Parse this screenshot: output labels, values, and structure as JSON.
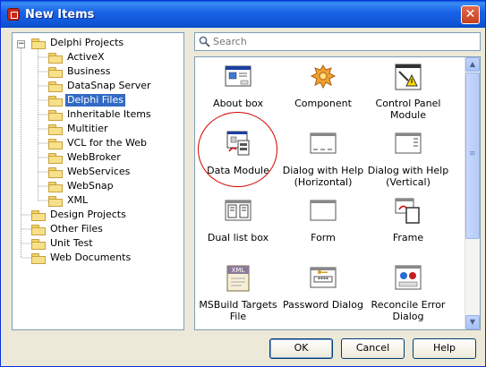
{
  "window": {
    "title": "New Items",
    "close_symbol": "✕"
  },
  "search": {
    "placeholder": "Search"
  },
  "tree": {
    "root": {
      "label": "Delphi Projects",
      "expander": "−"
    },
    "children": [
      {
        "label": "ActiveX"
      },
      {
        "label": "Business"
      },
      {
        "label": "DataSnap Server"
      },
      {
        "label": "Delphi Files",
        "selected": true
      },
      {
        "label": "Inheritable Items"
      },
      {
        "label": "Multitier"
      },
      {
        "label": "VCL for the Web"
      },
      {
        "label": "WebBroker"
      },
      {
        "label": "WebServices"
      },
      {
        "label": "WebSnap"
      },
      {
        "label": "XML"
      }
    ],
    "others": [
      {
        "label": "Design Projects"
      },
      {
        "label": "Other Files"
      },
      {
        "label": "Unit Test"
      },
      {
        "label": "Web Documents"
      }
    ]
  },
  "items": [
    {
      "caption": "About box",
      "icon": "about-box-icon"
    },
    {
      "caption": "Component",
      "icon": "component-icon"
    },
    {
      "caption": "Control Panel Module",
      "icon": "control-panel-module-icon"
    },
    {
      "caption": "Data Module",
      "icon": "data-module-icon",
      "highlighted": true
    },
    {
      "caption": "Dialog with Help (Horizontal)",
      "icon": "dialog-help-horizontal-icon"
    },
    {
      "caption": "Dialog with Help (Vertical)",
      "icon": "dialog-help-vertical-icon"
    },
    {
      "caption": "Dual list box",
      "icon": "dual-list-box-icon"
    },
    {
      "caption": "Form",
      "icon": "form-icon"
    },
    {
      "caption": "Frame",
      "icon": "frame-icon"
    },
    {
      "caption": "MSBuild Targets File",
      "icon": "msbuild-targets-icon",
      "icon_text": "XML"
    },
    {
      "caption": "Password Dialog",
      "icon": "password-dialog-icon",
      "icon_text": "****"
    },
    {
      "caption": "Reconcile Error Dialog",
      "icon": "reconcile-error-dialog-icon"
    }
  ],
  "scrollbar": {
    "up_symbol": "▲",
    "down_symbol": "▼",
    "grip_symbol": "≡"
  },
  "buttons": {
    "ok": "OK",
    "cancel": "Cancel",
    "help": "Help"
  },
  "colors": {
    "title_bar": "#0f58d8",
    "selection": "#316ac5",
    "highlight_circle": "#d40000",
    "dialog_bg": "#ece9d8"
  }
}
